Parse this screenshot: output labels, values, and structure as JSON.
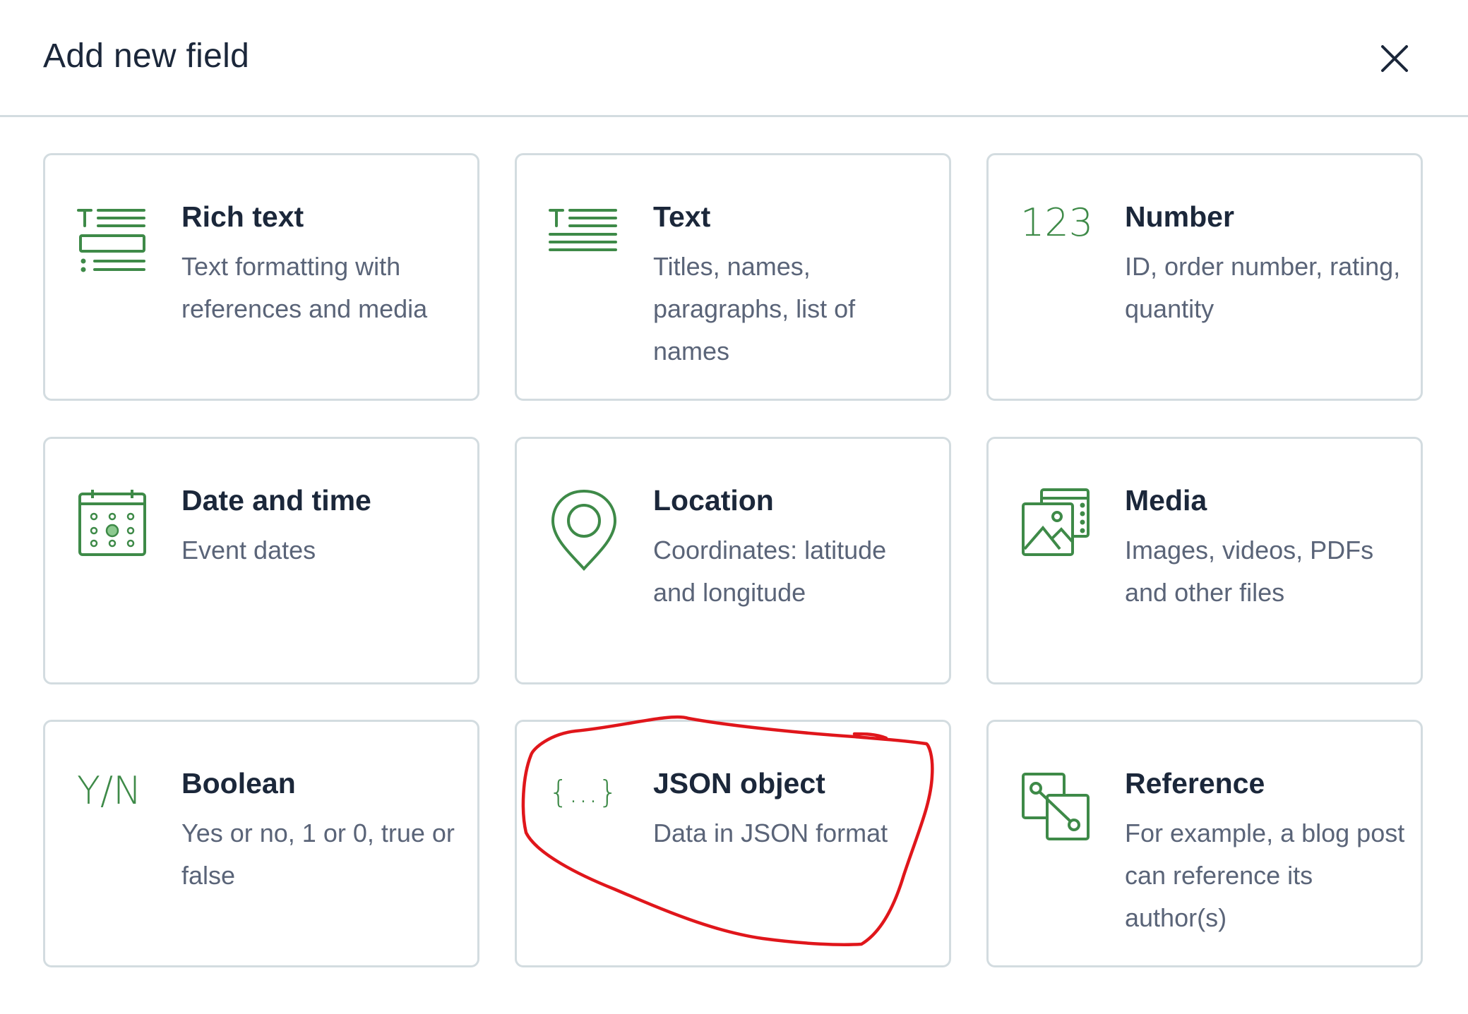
{
  "dialog": {
    "title": "Add new field",
    "close_icon": "close-icon"
  },
  "fields": [
    {
      "name": "Rich text",
      "description": "Text formatting with references and media",
      "icon": "rich-text-icon"
    },
    {
      "name": "Text",
      "description": "Titles, names, paragraphs, list of names",
      "icon": "text-icon"
    },
    {
      "name": "Number",
      "description": "ID, order number, rating, quantity",
      "icon": "number-icon",
      "icon_text": "123"
    },
    {
      "name": "Date and time",
      "description": "Event dates",
      "icon": "calendar-icon"
    },
    {
      "name": "Location",
      "description": "Coordinates: latitude and longitude",
      "icon": "location-pin-icon"
    },
    {
      "name": "Media",
      "description": "Images, videos, PDFs and other files",
      "icon": "media-icon"
    },
    {
      "name": "Boolean",
      "description": "Yes or no, 1 or 0, true or false",
      "icon": "boolean-icon",
      "icon_text": "Y/N"
    },
    {
      "name": "JSON object",
      "description": "Data in JSON format",
      "icon": "json-braces-icon",
      "icon_text": "{...}"
    },
    {
      "name": "Reference",
      "description": "For example, a blog post can reference its author(s)",
      "icon": "reference-icon"
    }
  ],
  "colors": {
    "icon_green": "#3e8a48",
    "title_text": "#1b273a",
    "description_text": "#5a6478",
    "card_border": "#d3dce0",
    "annotation_red": "#e0161b"
  },
  "annotation": {
    "type": "hand-drawn circle",
    "target": "JSON object"
  }
}
